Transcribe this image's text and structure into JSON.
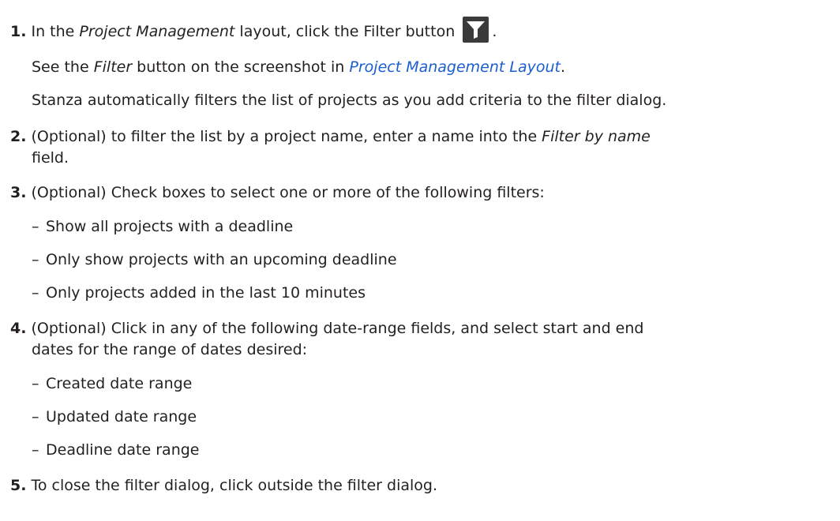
{
  "steps": {
    "s1": {
      "num": "1.",
      "pre": "In the ",
      "italic": "Project Management",
      "post": " layout, click the Filter button",
      "end": "."
    },
    "s1_note1": {
      "pre": "See the ",
      "italic": "Filter",
      "mid": " button on the screenshot in ",
      "link": "Project Management Layout",
      "end": "."
    },
    "s1_note2": "Stanza automatically filters the list of projects as you add criteria to the filter dialog.",
    "s2": {
      "num": "2.",
      "pre": "(Optional) to filter the list by a project name, enter a name into the ",
      "italic": "Filter by name",
      "cont": "field."
    },
    "s3": {
      "num": "3.",
      "text": "(Optional) Check boxes to select one or more of the following filters:",
      "bullets": [
        "Show all projects with a deadline",
        "Only show projects with an upcoming deadline",
        "Only projects added in the last 10 minutes"
      ]
    },
    "s4": {
      "num": "4.",
      "text": "(Optional) Click in any of the following date-range fields, and select start and end",
      "cont": "dates for the range of dates desired:",
      "bullets": [
        "Created date range",
        "Updated date range",
        "Deadline date range"
      ]
    },
    "s5": {
      "num": "5.",
      "text": "To close the filter dialog, click outside the filter dialog."
    }
  },
  "bullet_char": "–",
  "icons": {
    "filter": "filter-funnel-icon"
  },
  "colors": {
    "text": "#231f20",
    "link": "#1a5ecf",
    "button_bg": "#3a3a3a"
  }
}
